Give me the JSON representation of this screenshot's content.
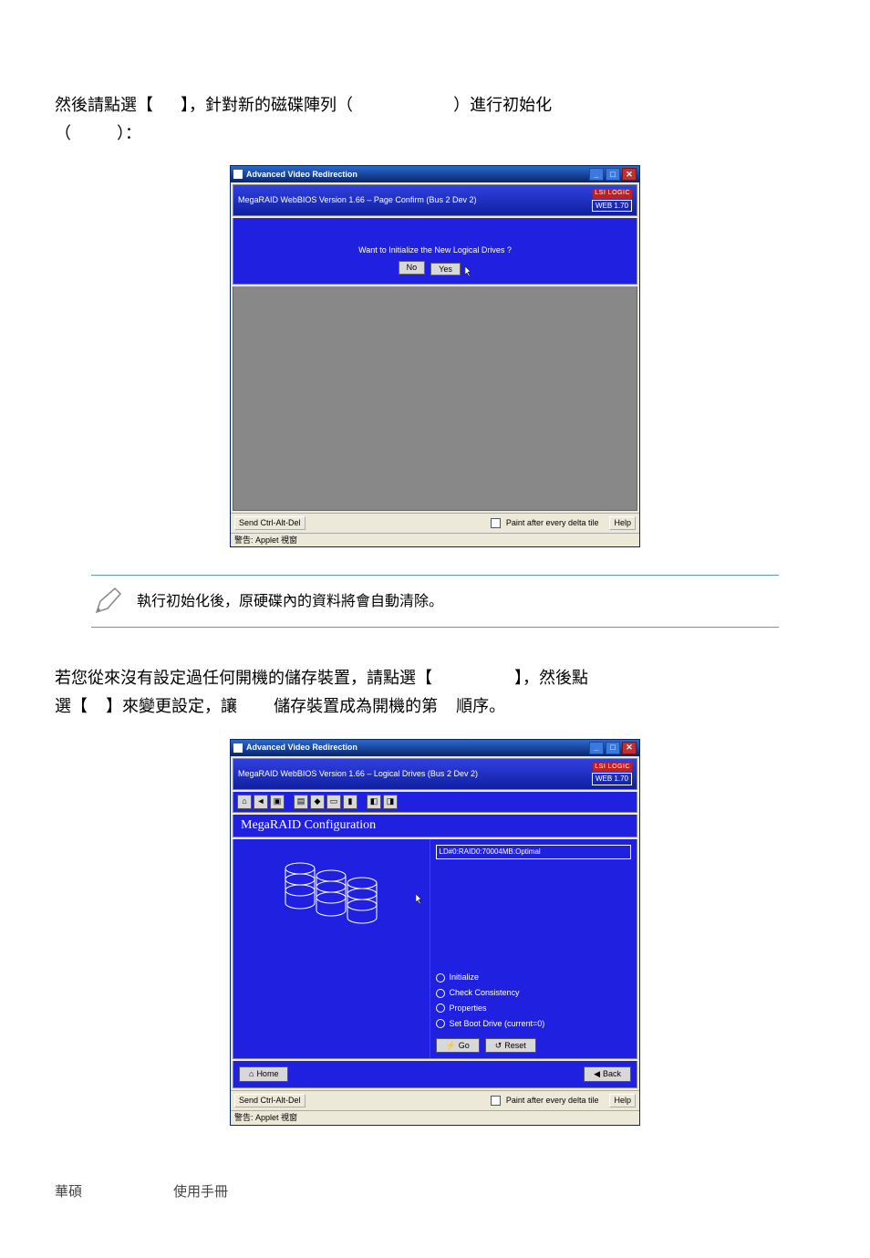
{
  "paragraph1_parts": {
    "p1": "然後請點選【",
    "p2": "】，針對新的磁碟陣列（",
    "p3": "）進行初始化",
    "p4": "（",
    "p5": "）："
  },
  "screenshot1": {
    "title": "Advanced Video Redirection",
    "inner_title": "MegaRAID WebBIOS Version 1.66 – Page Confirm (Bus 2 Dev 2)",
    "web_badge": "WEB 1.70",
    "brand": "LSI LOGIC",
    "prompt": "Want to Initialize the New Logical Drives ?",
    "no_btn": "No",
    "yes_btn": "Yes",
    "send_cad": "Send Ctrl-Alt-Del",
    "paint_label": "Paint after every delta tile",
    "help": "Help",
    "status": "警告: Applet 視窗"
  },
  "note_text": "執行初始化後，原硬碟內的資料將會自動清除。",
  "paragraph2_parts": {
    "p1": "若您從來沒有設定過任何開機的儲存裝置，請點選【",
    "p2": "】，然後點",
    "p3": "選【",
    "p4": "】來變更設定，讓",
    "p5": "儲存裝置成為開機的第",
    "p6": "順序。"
  },
  "screenshot2": {
    "title": "Advanced Video Redirection",
    "inner_title": "MegaRAID WebBIOS Version 1.66 – Logical Drives (Bus 2 Dev 2)",
    "web_badge": "WEB 1.70",
    "brand": "LSI LOGIC",
    "section_title": "MegaRAID Configuration",
    "ld_entry": "LD#0:RAID0:70004MB:Optimal",
    "radios": {
      "initialize": "Initialize",
      "check": "Check Consistency",
      "properties": "Properties",
      "setboot": "Set Boot Drive (current=0)"
    },
    "go_btn": "Go",
    "reset_btn": "Reset",
    "home_btn": "Home",
    "back_btn": "Back",
    "send_cad": "Send Ctrl-Alt-Del",
    "paint_label": "Paint after every delta tile",
    "help": "Help",
    "status": "警告: Applet 視窗"
  },
  "footer_left": "華碩",
  "footer_right": "使用手冊"
}
